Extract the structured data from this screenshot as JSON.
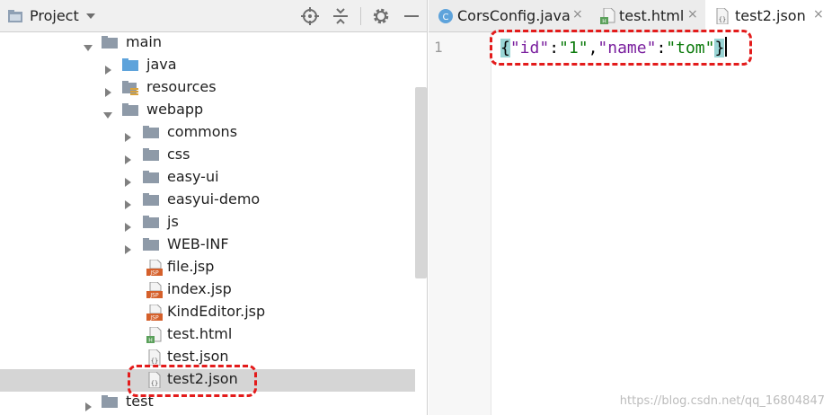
{
  "project_panel": {
    "title": "Project",
    "toolbar_icons": [
      "chevron-down-icon",
      "locate-icon",
      "collapse-icon",
      "gear-icon",
      "minimize-icon"
    ],
    "tree": [
      {
        "label": "main",
        "icon": "folder-icon",
        "expanded": true
      },
      {
        "label": "java",
        "icon": "source-folder-icon",
        "expanded": false
      },
      {
        "label": "resources",
        "icon": "resources-folder-icon",
        "expanded": false
      },
      {
        "label": "webapp",
        "icon": "folder-icon",
        "expanded": true
      },
      {
        "label": "commons",
        "icon": "folder-icon",
        "expanded": false
      },
      {
        "label": "css",
        "icon": "folder-icon",
        "expanded": false
      },
      {
        "label": "easy-ui",
        "icon": "folder-icon",
        "expanded": false
      },
      {
        "label": "easyui-demo",
        "icon": "folder-icon",
        "expanded": false
      },
      {
        "label": "js",
        "icon": "folder-icon",
        "expanded": false
      },
      {
        "label": "WEB-INF",
        "icon": "folder-icon",
        "expanded": false
      },
      {
        "label": "file.jsp",
        "icon": "jsp-file-icon"
      },
      {
        "label": "index.jsp",
        "icon": "jsp-file-icon"
      },
      {
        "label": "KindEditor.jsp",
        "icon": "jsp-file-icon"
      },
      {
        "label": "test.html",
        "icon": "html-file-icon"
      },
      {
        "label": "test.json",
        "icon": "json-file-icon"
      },
      {
        "label": "test2.json",
        "icon": "json-file-icon",
        "selected": true
      },
      {
        "label": "test",
        "icon": "folder-icon",
        "expanded": false
      }
    ]
  },
  "editor": {
    "tabs": [
      {
        "label": "CorsConfig.java",
        "icon": "java-class-icon",
        "close": "×",
        "active": false
      },
      {
        "label": "test.html",
        "icon": "html-file-icon",
        "close": "×",
        "active": false
      },
      {
        "label": "test2.json",
        "icon": "json-file-icon",
        "close": "×",
        "active": true
      }
    ],
    "line_number": "1",
    "code": {
      "open_brace": "{",
      "key1": "\"id\"",
      "colon1": ":",
      "val1": "\"1\"",
      "comma": ",",
      "key2": "\"name\"",
      "colon2": ":",
      "val2": "\"tom\"",
      "close_brace": "}"
    }
  },
  "watermark": "https://blog.csdn.net/qq_16804847",
  "colors": {
    "highlight_callout": "#e31b1b",
    "selection_bg": "#d5d5d5",
    "json_key": "#7a1f9e",
    "json_string": "#0b7a0b",
    "brace_match": "#99d5d5"
  }
}
